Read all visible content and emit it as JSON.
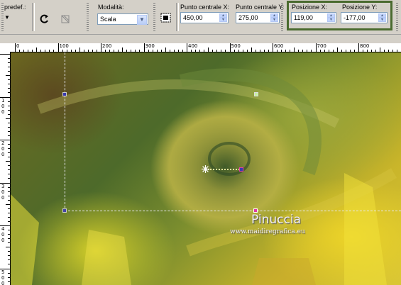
{
  "toolbar": {
    "preset_label": "predef.:",
    "mode_label": "Modalità:",
    "mode_value": "Scala",
    "center_x_label": "Punto centrale X:",
    "center_x_value": "450,00",
    "center_y_label": "Punto centrale Y:",
    "center_y_value": "275,00",
    "pos_x_label": "Posizione X:",
    "pos_x_value": "119,00",
    "pos_y_label": "Posizione Y:",
    "pos_y_value": "-177,00",
    "highlight_color": "#4a6b2f"
  },
  "ruler": {
    "top_labels": [
      "0",
      "100",
      "200",
      "300",
      "400",
      "500",
      "600",
      "700",
      "800"
    ],
    "left_labels": [
      "1 0 0",
      "2 0 0",
      "3 0 0",
      "4 0 0",
      "5 0 0"
    ]
  },
  "canvas": {
    "watermark_name": "Pinuccia",
    "watermark_url": "www.maidiregrafica.eu"
  },
  "icons": {
    "reset": "rotate-arrow-icon",
    "pick": "crop-select-icon",
    "fit": "fit-center-icon"
  }
}
